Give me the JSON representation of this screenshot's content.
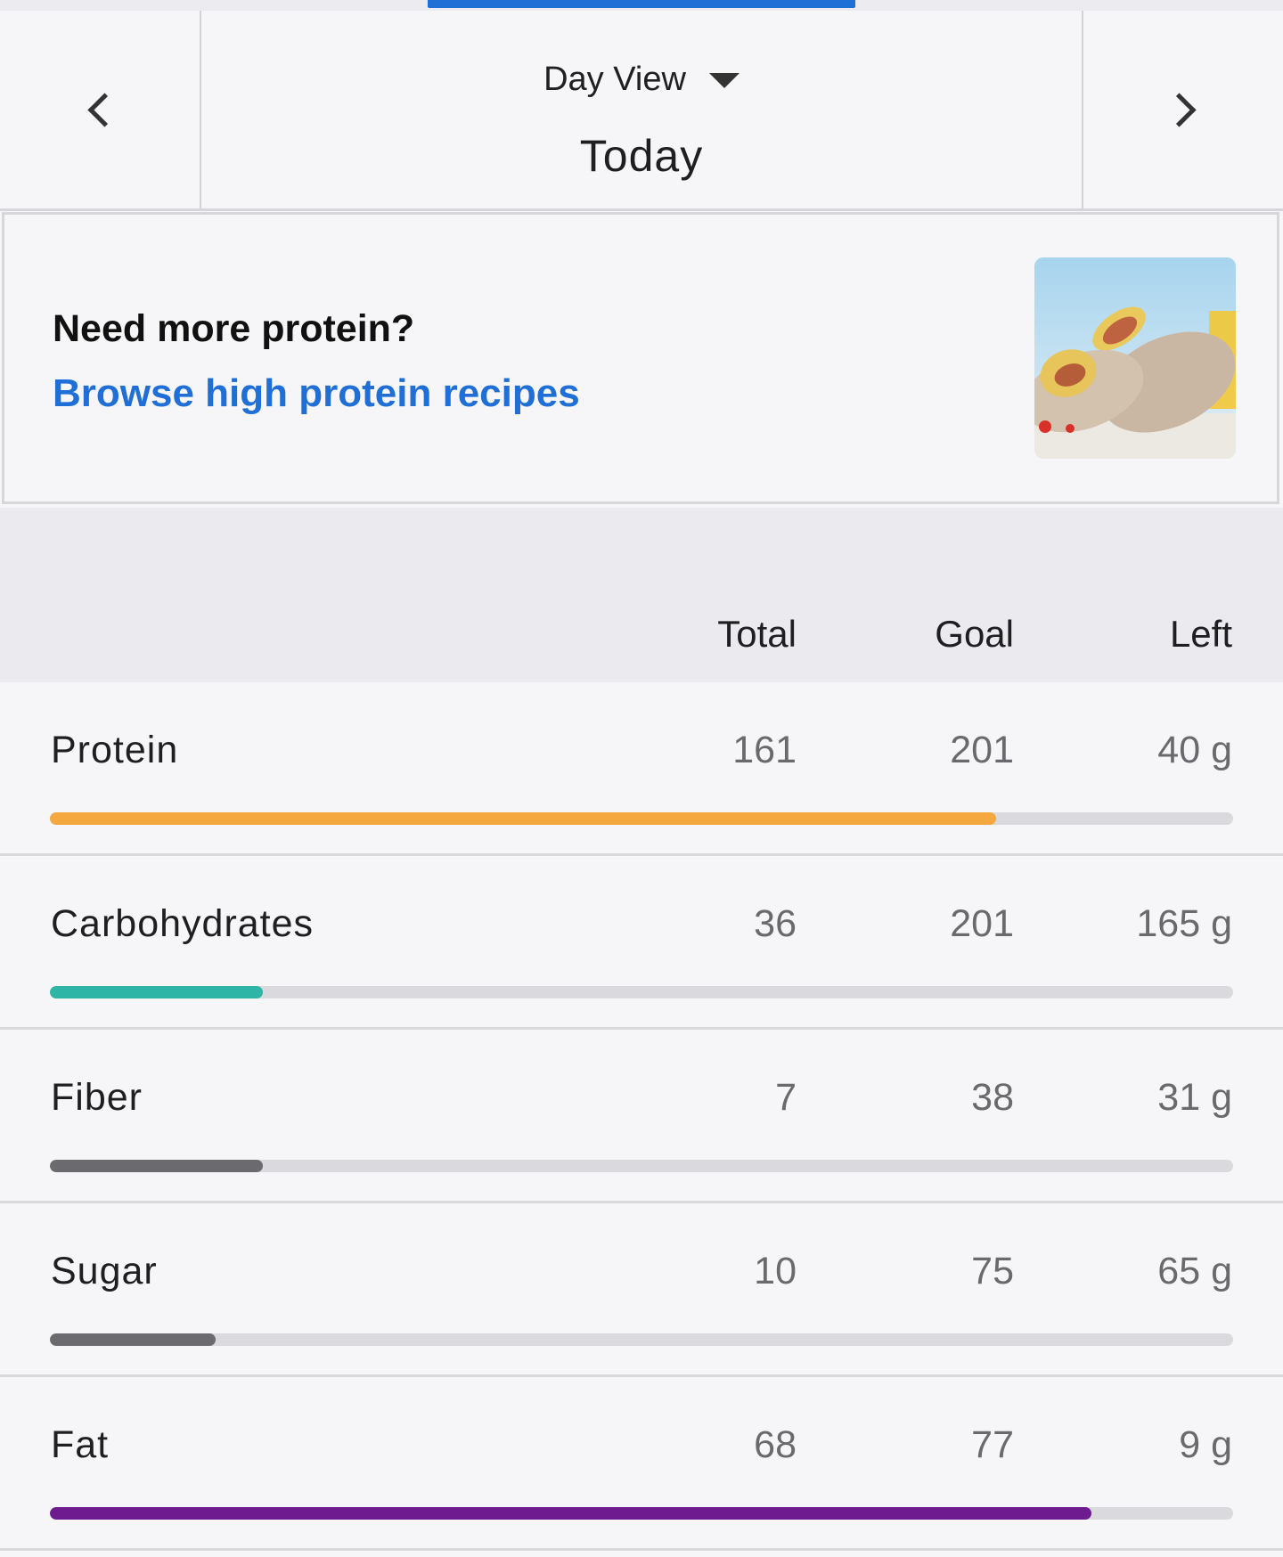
{
  "header": {
    "view_label": "Day View",
    "date_label": "Today"
  },
  "promo": {
    "title": "Need more protein?",
    "link": "Browse high protein recipes",
    "image": "wrap-recipe-photo"
  },
  "table": {
    "columns": [
      "Total",
      "Goal",
      "Left"
    ],
    "rows": [
      {
        "label": "Protein",
        "total": "161",
        "goal": "201",
        "left": "40 g",
        "progress": 0.8,
        "color": "#f5a83f"
      },
      {
        "label": "Carbohydrates",
        "total": "36",
        "goal": "201",
        "left": "165 g",
        "progress": 0.18,
        "color": "#2fb5a5"
      },
      {
        "label": "Fiber",
        "total": "7",
        "goal": "38",
        "left": "31 g",
        "progress": 0.18,
        "color": "#6b6b6f"
      },
      {
        "label": "Sugar",
        "total": "10",
        "goal": "75",
        "left": "65 g",
        "progress": 0.14,
        "color": "#6b6b6f"
      },
      {
        "label": "Fat",
        "total": "68",
        "goal": "77",
        "left": "9 g",
        "progress": 0.88,
        "color": "#6e1b8f"
      }
    ]
  },
  "colors": {
    "accent": "#1f6fd6",
    "background": "#f6f6f8"
  }
}
